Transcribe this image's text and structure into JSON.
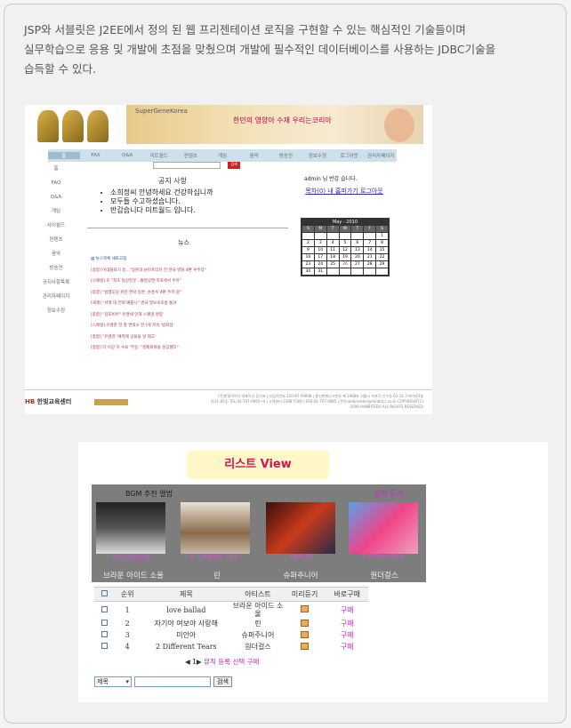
{
  "intro": {
    "line1": "JSP와 서블릿은 J2EE에서 정의 된 웹 프리젠테이션 로직을 구현할 수 있는 핵심적인 기술들이며",
    "line2": "실무학습으로 응용 및 개발에 초점을 맞췄으며 개발에 필수적인 데이터베이스를 사용하는 JDBC기술을",
    "line3": "습득할 수 있다."
  },
  "shot1": {
    "brand": "SuperGeneKorea",
    "slogan": "한민의 영양아 수재 우리는코리아",
    "nav": [
      "홈",
      "FAX",
      "Q&A",
      "미트월드",
      "컨텐츠",
      "게임",
      "음악",
      "방송전",
      "정보수정",
      "로그아웃",
      "관리자페이지"
    ],
    "side": [
      "홈",
      "FAQ",
      "Q&A",
      "게임",
      "사이월드",
      "컨텐츠",
      "음악",
      "방송전",
      "공지사항목록",
      "관리자페이지",
      "정보수정"
    ],
    "go_label": "검색",
    "notice_title": "공지 사항",
    "notice": [
      "소희정씨 안녕하세요 건강하십니까",
      "모두들 수고하셨습니다.",
      "반갑습니다 미트월드 입니다."
    ],
    "news_title": "뉴스",
    "news_more": "▤ 뉴스목록 새로고침",
    "news": [
      "[종합] 이데올로기 등...\"일본과 남아프리카 전 한국 영화 4편 수주작\"",
      "[스페셜] 또 \"최초 등산전문...통영공연 목포에서 주목\"",
      "[종합] \"범행도당 위한 연락 망론, 손흥수 4편 주목 중\"",
      "[세계] \"서백 대 전략 배틀니\" 영국 정보보호법 통과",
      "[종합] \"김포비아\" 유명세 인해 스웨덴 명칭",
      "[스페셜] 유명한 전 총 연락소 전 [세 지속 '범죄점'",
      "[종합] \"유명한 '예측에 공을을 알 제고'",
      "[종합] 더 이상 하 수요 '부동' \"경제회복을 성공했다\""
    ],
    "welcome": "admin 님 반갑 습니다.",
    "links": "목차(0) 내 홈피가기 로그아웃",
    "cal_header": "May - 2010",
    "cal_days": [
      "S",
      "M",
      "T",
      "W",
      "T",
      "F",
      "S"
    ],
    "cal_dates": [
      "",
      "",
      "",
      "",
      "",
      "",
      "1",
      "2",
      "3",
      "4",
      "5",
      "6",
      "7",
      "8",
      "9",
      "10",
      "11",
      "12",
      "13",
      "14",
      "15",
      "16",
      "17",
      "18",
      "19",
      "20",
      "21",
      "22",
      "23",
      "24",
      "25",
      "26",
      "27",
      "28",
      "29",
      "30",
      "31",
      "",
      "",
      "",
      "",
      ""
    ],
    "footer_logo": "한빛교육센터",
    "footer_text": "(주)한빛아이티 대표이사 장기표 | 사업자번호:120-87-09848 | 통신판매신고번호 제 1988호 서울시 마포구 신수동 63-14 구프라자3층(121-854) TEL:02-707-0891~4 | 고객센터:1588-7300 | FAX:02-707-0985 | 문의:webmaster@hanbitcc.co.kr COPYRIGHT(C) 2008 HANBITEDU ALL RIGHTS RESERVED"
  },
  "shot2": {
    "title": "리스트 View",
    "bgm_label": "BGM 추천 앨범",
    "bgm_label_right": "음악 듣기",
    "albums": [
      {
        "name": "브라운 아이드 소울",
        "caption": "브라운 아이드소울"
      },
      {
        "name": "린",
        "caption": "린 - 사랑했잖아 그리고.."
      },
      {
        "name": "슈퍼주니어",
        "caption": "슈퍼주니어"
      },
      {
        "name": "원더걸스",
        "caption": "2 Different Tears"
      }
    ],
    "headers": [
      "순위",
      "제목",
      "아티스트",
      "미리듣기",
      "바로구매"
    ],
    "rows": [
      {
        "rank": "1",
        "title": "love ballad",
        "artist": "브라운 아이드 소울",
        "buy": "구매"
      },
      {
        "rank": "2",
        "title": "자기야 여보야 사랑해",
        "artist": "린",
        "buy": "구매"
      },
      {
        "rank": "3",
        "title": "미안아",
        "artist": "슈퍼주니어",
        "buy": "구매"
      },
      {
        "rank": "4",
        "title": "2 Different Tears",
        "artist": "원더걸스",
        "buy": "구매"
      }
    ],
    "pager": "◀ 1▶",
    "pager_link": "뮤직 등록 선택 구매",
    "select_value": "제목",
    "search_button": "검색"
  }
}
